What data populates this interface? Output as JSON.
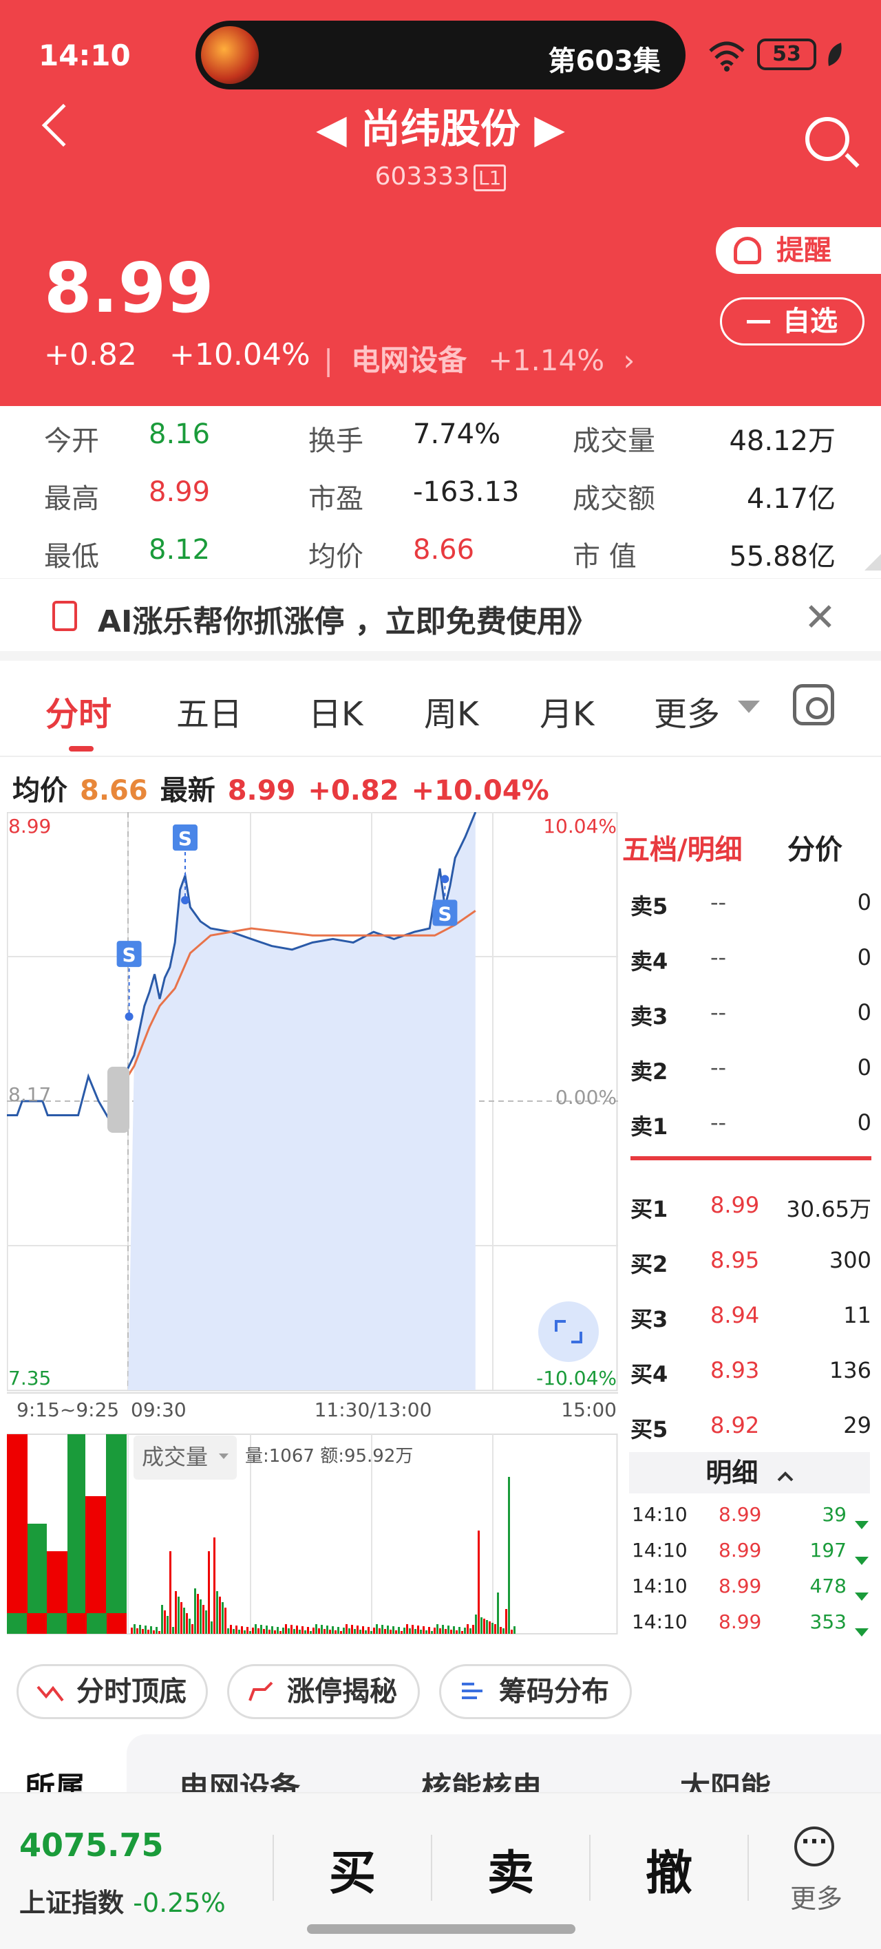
{
  "status_bar": {
    "time": "14:10",
    "episode": "第603集",
    "battery": "53"
  },
  "header": {
    "prev_arrow": "◀",
    "title": "尚纬股份",
    "next_arrow": "▶",
    "code": "603333",
    "level": "L1",
    "price": "8.99",
    "change": "+0.82",
    "change_pct": "+10.04%",
    "divider": "|",
    "sector": "电网设备",
    "sector_pct": "+1.14%",
    "sector_arrow": "›",
    "remind_label": "提醒",
    "fav_label": "自选"
  },
  "stats": [
    {
      "label": "今开",
      "value": "8.16",
      "color": "green"
    },
    {
      "label": "换手",
      "value": "7.74%",
      "color": "black"
    },
    {
      "label": "成交量",
      "value": "48.12万",
      "color": "black"
    },
    {
      "label": "最高",
      "value": "8.99",
      "color": "red"
    },
    {
      "label": "市盈",
      "value": "-163.13",
      "color": "black"
    },
    {
      "label": "成交额",
      "value": "4.17亿",
      "color": "black"
    },
    {
      "label": "最低",
      "value": "8.12",
      "color": "green"
    },
    {
      "label": "均价",
      "value": "8.66",
      "color": "red"
    },
    {
      "label": "市 值",
      "value": "55.88亿",
      "color": "black"
    }
  ],
  "ad": {
    "text": "AI涨乐帮你抓涨停 ，立即免费使用》",
    "close": "✕"
  },
  "tabs": [
    "分时",
    "五日",
    "日K",
    "周K",
    "月K",
    "更多"
  ],
  "chart_info": {
    "avg_label": "均价",
    "avg_value": "8.66",
    "latest_label": "最新",
    "latest_value": "8.99",
    "latest_change": "+0.82",
    "latest_pct": "+10.04%"
  },
  "chart_data": {
    "type": "line",
    "title": "",
    "ylim": [
      7.35,
      8.99
    ],
    "y_labels": {
      "top": "8.99",
      "bottom": "7.35",
      "top_pct": "10.04%",
      "mid_pct": "0.00%",
      "bottom_pct": "-10.04%",
      "mid_left": "8.17"
    },
    "x_labels": [
      "9:15~9:25",
      "09:30",
      "11:30/13:00",
      "15:00"
    ],
    "grid": true,
    "series": [],
    "price_path": [
      [
        0.0,
        8.13
      ],
      [
        0.02,
        8.13
      ],
      [
        0.03,
        8.17
      ],
      [
        0.07,
        8.17
      ],
      [
        0.08,
        8.13
      ],
      [
        0.14,
        8.13
      ],
      [
        0.16,
        8.24
      ],
      [
        0.18,
        8.17
      ],
      [
        0.2,
        8.12
      ],
      [
        0.21,
        8.2
      ],
      [
        0.23,
        8.24
      ],
      [
        0.25,
        8.3
      ],
      [
        0.27,
        8.44
      ],
      [
        0.28,
        8.48
      ],
      [
        0.29,
        8.53
      ],
      [
        0.3,
        8.46
      ],
      [
        0.31,
        8.52
      ],
      [
        0.32,
        8.55
      ],
      [
        0.33,
        8.62
      ],
      [
        0.34,
        8.77
      ],
      [
        0.35,
        8.81
      ],
      [
        0.36,
        8.72
      ],
      [
        0.38,
        8.68
      ],
      [
        0.4,
        8.66
      ],
      [
        0.44,
        8.65
      ],
      [
        0.48,
        8.63
      ],
      [
        0.52,
        8.61
      ],
      [
        0.56,
        8.6
      ],
      [
        0.6,
        8.62
      ],
      [
        0.64,
        8.63
      ],
      [
        0.68,
        8.62
      ],
      [
        0.72,
        8.65
      ],
      [
        0.76,
        8.63
      ],
      [
        0.8,
        8.65
      ],
      [
        0.83,
        8.66
      ],
      [
        0.84,
        8.75
      ],
      [
        0.85,
        8.83
      ],
      [
        0.86,
        8.72
      ],
      [
        0.87,
        8.78
      ],
      [
        0.88,
        8.86
      ],
      [
        0.9,
        8.92
      ],
      [
        0.92,
        8.99
      ]
    ],
    "avg_path": [
      [
        0.2,
        8.13
      ],
      [
        0.22,
        8.2
      ],
      [
        0.25,
        8.27
      ],
      [
        0.28,
        8.38
      ],
      [
        0.3,
        8.44
      ],
      [
        0.33,
        8.49
      ],
      [
        0.36,
        8.59
      ],
      [
        0.4,
        8.64
      ],
      [
        0.48,
        8.66
      ],
      [
        0.6,
        8.64
      ],
      [
        0.72,
        8.64
      ],
      [
        0.84,
        8.64
      ],
      [
        0.88,
        8.67
      ],
      [
        0.92,
        8.71
      ]
    ],
    "markers": [
      {
        "x": 0.24,
        "y": 8.41,
        "label": "S"
      },
      {
        "x": 0.35,
        "y": 8.74,
        "label": "S"
      },
      {
        "x": 0.86,
        "y": 8.8,
        "label": "S"
      }
    ],
    "volume_label": "成交量",
    "volume_info": "量:1067 额:95.92万"
  },
  "orderbook": {
    "tab_active": "五档/明细",
    "tab_other": "分价",
    "asks": [
      {
        "label": "卖5",
        "price": "--",
        "vol": "0"
      },
      {
        "label": "卖4",
        "price": "--",
        "vol": "0"
      },
      {
        "label": "卖3",
        "price": "--",
        "vol": "0"
      },
      {
        "label": "卖2",
        "price": "--",
        "vol": "0"
      },
      {
        "label": "卖1",
        "price": "--",
        "vol": "0"
      }
    ],
    "bids": [
      {
        "label": "买1",
        "price": "8.99",
        "vol": "30.65万"
      },
      {
        "label": "买2",
        "price": "8.95",
        "vol": "300"
      },
      {
        "label": "买3",
        "price": "8.94",
        "vol": "11"
      },
      {
        "label": "买4",
        "price": "8.93",
        "vol": "136"
      },
      {
        "label": "买5",
        "price": "8.92",
        "vol": "29"
      }
    ],
    "detail_title": "明细",
    "details": [
      {
        "time": "14:10",
        "price": "8.99",
        "vol": "39"
      },
      {
        "time": "14:10",
        "price": "8.99",
        "vol": "197"
      },
      {
        "time": "14:10",
        "price": "8.99",
        "vol": "478"
      },
      {
        "time": "14:10",
        "price": "8.99",
        "vol": "353"
      }
    ]
  },
  "tools": [
    "分时顶底",
    "涨停揭秘",
    "筹码分布"
  ],
  "related": [
    "所属",
    "电网设备",
    "核能核电",
    "太阳能"
  ],
  "bottom": {
    "index_value": "4075.75",
    "index_name": "上证指数",
    "index_change": "-0.25%",
    "buy": "买",
    "sell": "卖",
    "cancel": "撤",
    "more": "更多",
    "more_icon": "···"
  },
  "colors": {
    "brand": "#ef4248",
    "up": "#e83a3f",
    "down": "#1a9b3a",
    "price_line": "#2a5aa8",
    "avg_line": "#e8734a"
  }
}
